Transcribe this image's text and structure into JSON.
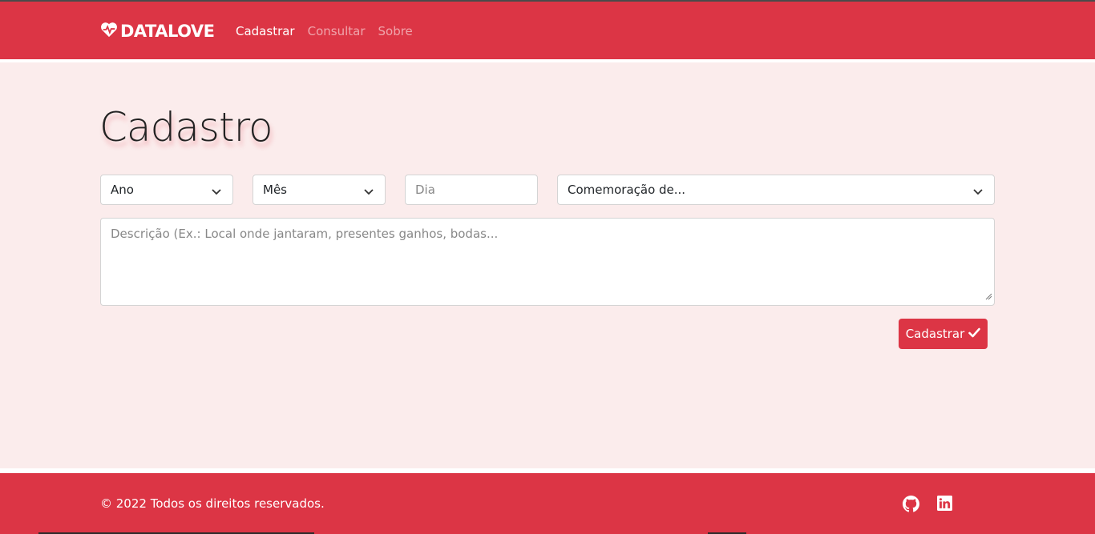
{
  "brand": {
    "name": "DATALOVE",
    "icon": "heart-pulse-icon"
  },
  "nav": {
    "items": [
      {
        "label": "Cadastrar",
        "active": true
      },
      {
        "label": "Consultar",
        "active": false
      },
      {
        "label": "Sobre",
        "active": false
      }
    ]
  },
  "page": {
    "title": "Cadastro"
  },
  "form": {
    "year_select": "Ano",
    "month_select": "Mês",
    "day_placeholder": "Dia",
    "occasion_select": "Comemoração de...",
    "description_placeholder": "Descrição (Ex.: Local onde jantaram, presentes ganhos, bodas...",
    "submit_label": "Cadastrar",
    "submit_icon": "check-icon"
  },
  "footer": {
    "copyright": "© 2022 Todos os direitos reservados.",
    "social": [
      {
        "icon": "github-icon"
      },
      {
        "icon": "linkedin-icon"
      }
    ]
  },
  "colors": {
    "primary": "#dc3545",
    "background": "#fbecec"
  }
}
